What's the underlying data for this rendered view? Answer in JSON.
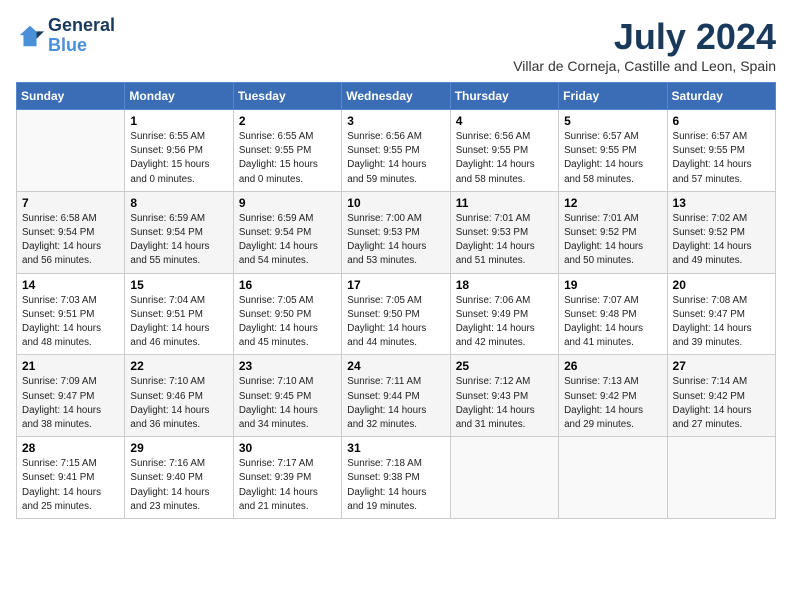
{
  "logo": {
    "line1": "General",
    "line2": "Blue"
  },
  "title": "July 2024",
  "location": "Villar de Corneja, Castille and Leon, Spain",
  "days_of_week": [
    "Sunday",
    "Monday",
    "Tuesday",
    "Wednesday",
    "Thursday",
    "Friday",
    "Saturday"
  ],
  "weeks": [
    [
      {
        "day": "",
        "info": ""
      },
      {
        "day": "1",
        "info": "Sunrise: 6:55 AM\nSunset: 9:56 PM\nDaylight: 15 hours\nand 0 minutes."
      },
      {
        "day": "2",
        "info": "Sunrise: 6:55 AM\nSunset: 9:55 PM\nDaylight: 15 hours\nand 0 minutes."
      },
      {
        "day": "3",
        "info": "Sunrise: 6:56 AM\nSunset: 9:55 PM\nDaylight: 14 hours\nand 59 minutes."
      },
      {
        "day": "4",
        "info": "Sunrise: 6:56 AM\nSunset: 9:55 PM\nDaylight: 14 hours\nand 58 minutes."
      },
      {
        "day": "5",
        "info": "Sunrise: 6:57 AM\nSunset: 9:55 PM\nDaylight: 14 hours\nand 58 minutes."
      },
      {
        "day": "6",
        "info": "Sunrise: 6:57 AM\nSunset: 9:55 PM\nDaylight: 14 hours\nand 57 minutes."
      }
    ],
    [
      {
        "day": "7",
        "info": "Sunrise: 6:58 AM\nSunset: 9:54 PM\nDaylight: 14 hours\nand 56 minutes."
      },
      {
        "day": "8",
        "info": "Sunrise: 6:59 AM\nSunset: 9:54 PM\nDaylight: 14 hours\nand 55 minutes."
      },
      {
        "day": "9",
        "info": "Sunrise: 6:59 AM\nSunset: 9:54 PM\nDaylight: 14 hours\nand 54 minutes."
      },
      {
        "day": "10",
        "info": "Sunrise: 7:00 AM\nSunset: 9:53 PM\nDaylight: 14 hours\nand 53 minutes."
      },
      {
        "day": "11",
        "info": "Sunrise: 7:01 AM\nSunset: 9:53 PM\nDaylight: 14 hours\nand 51 minutes."
      },
      {
        "day": "12",
        "info": "Sunrise: 7:01 AM\nSunset: 9:52 PM\nDaylight: 14 hours\nand 50 minutes."
      },
      {
        "day": "13",
        "info": "Sunrise: 7:02 AM\nSunset: 9:52 PM\nDaylight: 14 hours\nand 49 minutes."
      }
    ],
    [
      {
        "day": "14",
        "info": "Sunrise: 7:03 AM\nSunset: 9:51 PM\nDaylight: 14 hours\nand 48 minutes."
      },
      {
        "day": "15",
        "info": "Sunrise: 7:04 AM\nSunset: 9:51 PM\nDaylight: 14 hours\nand 46 minutes."
      },
      {
        "day": "16",
        "info": "Sunrise: 7:05 AM\nSunset: 9:50 PM\nDaylight: 14 hours\nand 45 minutes."
      },
      {
        "day": "17",
        "info": "Sunrise: 7:05 AM\nSunset: 9:50 PM\nDaylight: 14 hours\nand 44 minutes."
      },
      {
        "day": "18",
        "info": "Sunrise: 7:06 AM\nSunset: 9:49 PM\nDaylight: 14 hours\nand 42 minutes."
      },
      {
        "day": "19",
        "info": "Sunrise: 7:07 AM\nSunset: 9:48 PM\nDaylight: 14 hours\nand 41 minutes."
      },
      {
        "day": "20",
        "info": "Sunrise: 7:08 AM\nSunset: 9:47 PM\nDaylight: 14 hours\nand 39 minutes."
      }
    ],
    [
      {
        "day": "21",
        "info": "Sunrise: 7:09 AM\nSunset: 9:47 PM\nDaylight: 14 hours\nand 38 minutes."
      },
      {
        "day": "22",
        "info": "Sunrise: 7:10 AM\nSunset: 9:46 PM\nDaylight: 14 hours\nand 36 minutes."
      },
      {
        "day": "23",
        "info": "Sunrise: 7:10 AM\nSunset: 9:45 PM\nDaylight: 14 hours\nand 34 minutes."
      },
      {
        "day": "24",
        "info": "Sunrise: 7:11 AM\nSunset: 9:44 PM\nDaylight: 14 hours\nand 32 minutes."
      },
      {
        "day": "25",
        "info": "Sunrise: 7:12 AM\nSunset: 9:43 PM\nDaylight: 14 hours\nand 31 minutes."
      },
      {
        "day": "26",
        "info": "Sunrise: 7:13 AM\nSunset: 9:42 PM\nDaylight: 14 hours\nand 29 minutes."
      },
      {
        "day": "27",
        "info": "Sunrise: 7:14 AM\nSunset: 9:42 PM\nDaylight: 14 hours\nand 27 minutes."
      }
    ],
    [
      {
        "day": "28",
        "info": "Sunrise: 7:15 AM\nSunset: 9:41 PM\nDaylight: 14 hours\nand 25 minutes."
      },
      {
        "day": "29",
        "info": "Sunrise: 7:16 AM\nSunset: 9:40 PM\nDaylight: 14 hours\nand 23 minutes."
      },
      {
        "day": "30",
        "info": "Sunrise: 7:17 AM\nSunset: 9:39 PM\nDaylight: 14 hours\nand 21 minutes."
      },
      {
        "day": "31",
        "info": "Sunrise: 7:18 AM\nSunset: 9:38 PM\nDaylight: 14 hours\nand 19 minutes."
      },
      {
        "day": "",
        "info": ""
      },
      {
        "day": "",
        "info": ""
      },
      {
        "day": "",
        "info": ""
      }
    ]
  ]
}
